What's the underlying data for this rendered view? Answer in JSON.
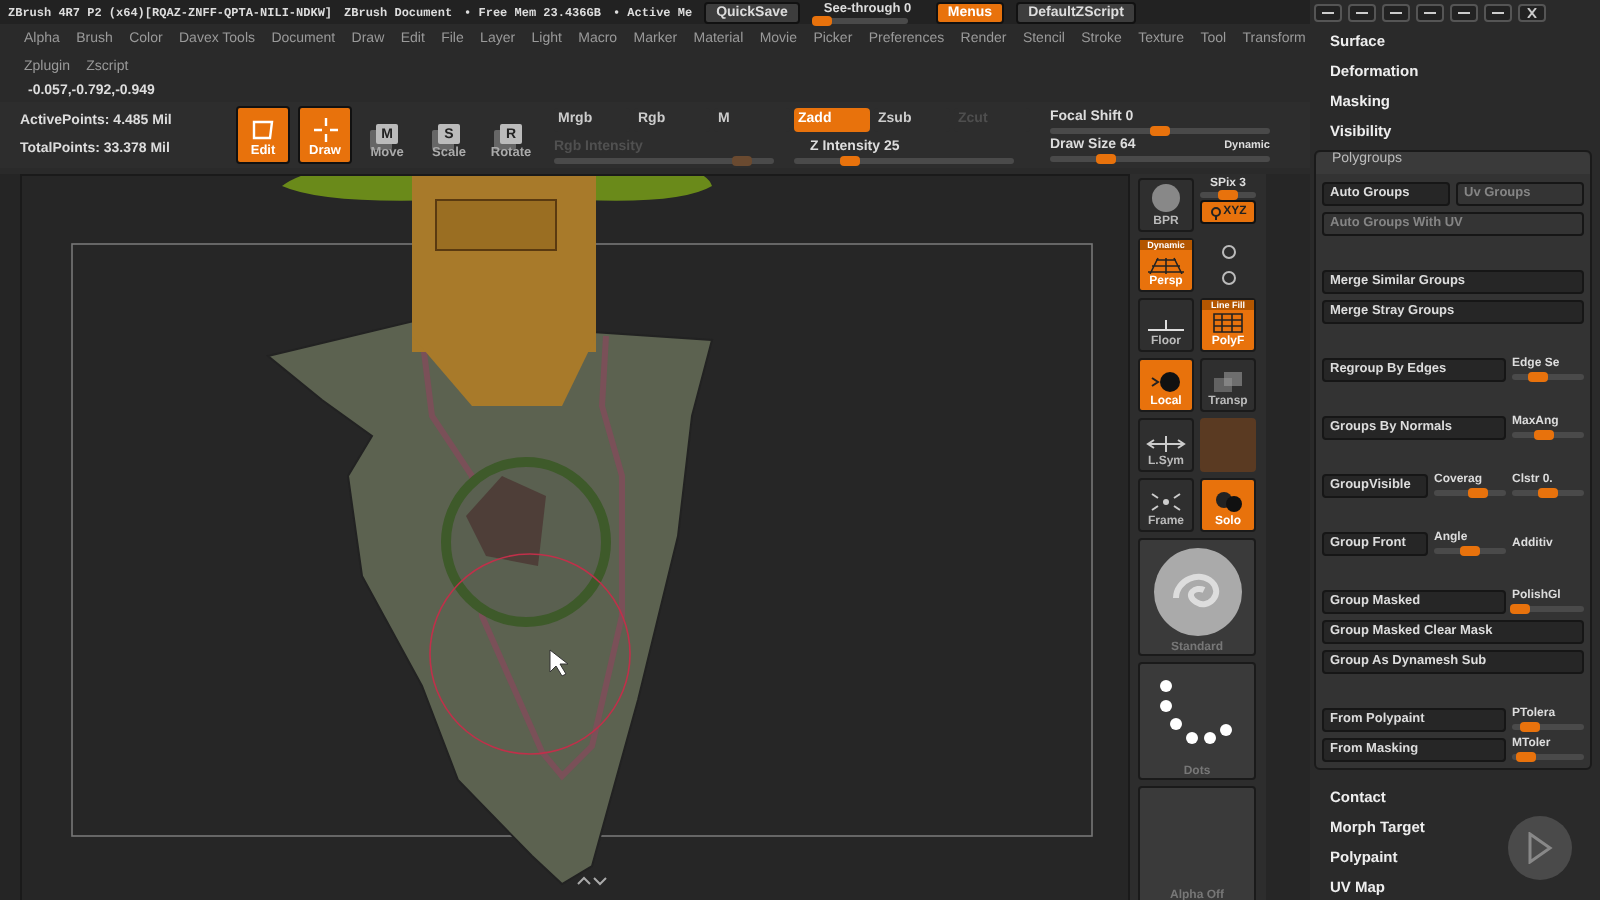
{
  "title_bar": {
    "app": "ZBrush 4R7 P2 (x64)[RQAZ-ZNFF-QPTA-NILI-NDKW]",
    "document": "ZBrush Document",
    "free_mem": "• Free Mem 23.436GB",
    "active_mem": "• Active Me",
    "quicksave": "QuickSave",
    "see_through": {
      "label": "See-through  0",
      "level": 0.1
    },
    "menus": {
      "label": "Menus",
      "on": true
    },
    "script": "DefaultZScript"
  },
  "menu_rows": [
    [
      "Alpha",
      "Brush",
      "Color",
      "Davex Tools",
      "Document",
      "Draw",
      "Edit",
      "File",
      "Layer",
      "Light",
      "Macro",
      "Marker",
      "Material",
      "Movie",
      "Picker",
      "Preferences",
      "Render",
      "Stencil",
      "Stroke",
      "Texture",
      "Tool",
      "Transform"
    ],
    [
      "Zplugin",
      "Zscript"
    ]
  ],
  "coordinates": "-0.057,-0.792,-0.949",
  "stats": [
    "ActivePoints: 4.485 Mil",
    "TotalPoints: 33.378 Mil"
  ],
  "tools": [
    {
      "label": "Edit",
      "kind": "edit",
      "on": true
    },
    {
      "label": "Draw",
      "kind": "draw",
      "on": true
    },
    {
      "label": "Move",
      "kind": "key",
      "key": "M",
      "on": false
    },
    {
      "label": "Scale",
      "kind": "key",
      "key": "S",
      "on": false
    },
    {
      "label": "Rotate",
      "kind": "key",
      "key": "R",
      "on": false
    }
  ],
  "modes": [
    {
      "label": "Mrgb",
      "selected": false,
      "disabled": false
    },
    {
      "label": "Rgb",
      "selected": false,
      "disabled": false
    },
    {
      "label": "M",
      "selected": false,
      "disabled": false
    },
    {
      "label": "Zadd",
      "selected": true,
      "disabled": false
    },
    {
      "label": "Zsub",
      "selected": false,
      "disabled": false
    },
    {
      "label": "Zcut",
      "selected": false,
      "disabled": true
    }
  ],
  "intensities": [
    {
      "label": "Rgb Intensity",
      "disabled": true,
      "level": 0.85
    },
    {
      "label": "Z Intensity 25",
      "disabled": false,
      "level": 0.25
    }
  ],
  "brush_settings": [
    {
      "label": "Focal Shift 0",
      "level": 0.5
    },
    {
      "label": "Draw Size 64",
      "level": 0.25
    }
  ],
  "dynamic": "Dynamic",
  "shelf": [
    {
      "kind": "render",
      "label": "BPR",
      "on": false
    },
    {
      "kind": "spix",
      "label": "SPix 3",
      "level": 0.5,
      "button": "XYZ",
      "on": true
    },
    {
      "kind": "persp",
      "label": "Persp",
      "caption": "Dynamic",
      "on": true
    },
    {
      "kind": "axes"
    },
    {
      "kind": "floor",
      "label": "Floor",
      "on": false
    },
    {
      "kind": "polyf",
      "label": "PolyF",
      "caption": "Line Fill",
      "on": true
    },
    {
      "kind": "local",
      "label": "Local",
      "on": true
    },
    {
      "kind": "transp",
      "label": "Transp",
      "on": false
    },
    {
      "kind": "lsym",
      "label": "L.Sym",
      "on": false
    },
    {
      "kind": "ghost"
    },
    {
      "kind": "frame",
      "label": "Frame",
      "on": false
    },
    {
      "kind": "solo",
      "label": "Solo",
      "on": true
    },
    {
      "kind": "brush",
      "label": "Standard"
    },
    {
      "kind": "stroke",
      "label": "Dots"
    },
    {
      "kind": "alpha",
      "label": "Alpha Off"
    }
  ],
  "panel": {
    "sections_top": [
      "Surface",
      "Deformation",
      "Masking",
      "Visibility"
    ],
    "polygroups": {
      "title": "Polygroups",
      "groups": [
        [
          [
            {
              "kind": "button",
              "label": "Auto Groups",
              "disabled": false
            },
            {
              "kind": "button",
              "label": "Uv Groups",
              "disabled": true
            }
          ],
          [
            {
              "kind": "button",
              "label": "Auto Groups With UV",
              "disabled": true
            }
          ]
        ],
        [
          [
            {
              "kind": "button",
              "label": "Merge Similar Groups",
              "disabled": false
            }
          ],
          [
            {
              "kind": "button",
              "label": "Merge Stray Groups",
              "disabled": false
            }
          ]
        ],
        [
          [
            {
              "kind": "button",
              "label": "Regroup By Edges",
              "disabled": false
            },
            {
              "kind": "slider",
              "label": "Edge Se",
              "level": 0.35
            }
          ]
        ],
        [
          [
            {
              "kind": "button",
              "label": "Groups By Normals",
              "disabled": false
            },
            {
              "kind": "slider",
              "label": "MaxAng",
              "level": 0.45
            }
          ]
        ],
        [
          [
            {
              "kind": "button",
              "label": "GroupVisible",
              "disabled": false
            },
            {
              "kind": "slider",
              "label": "Coverag",
              "level": 0.6
            },
            {
              "kind": "slider",
              "label": "Clstr 0.",
              "level": 0.5
            }
          ]
        ],
        [
          [
            {
              "kind": "button",
              "label": "Group Front",
              "disabled": false
            },
            {
              "kind": "slider",
              "label": "Angle",
              "level": 0.5
            },
            {
              "kind": "label",
              "label": "Additiv"
            }
          ]
        ],
        [
          [
            {
              "kind": "button",
              "label": "Group Masked",
              "disabled": false
            },
            {
              "kind": "slider",
              "label": "PolishGl",
              "level": 0.1
            }
          ],
          [
            {
              "kind": "button",
              "label": "Group Masked Clear Mask",
              "disabled": false
            }
          ],
          [
            {
              "kind": "button",
              "label": "Group As Dynamesh Sub",
              "disabled": false
            }
          ]
        ],
        [
          [
            {
              "kind": "button",
              "label": "From Polypaint",
              "disabled": false
            },
            {
              "kind": "slider",
              "label": "PTolera",
              "level": 0.25
            }
          ],
          [
            {
              "kind": "button",
              "label": "From Masking",
              "disabled": false
            },
            {
              "kind": "slider",
              "label": "MToler",
              "level": 0.2
            }
          ]
        ]
      ]
    },
    "sections_bottom": [
      "Contact",
      "Morph Target",
      "Polypaint",
      "UV Map"
    ]
  }
}
